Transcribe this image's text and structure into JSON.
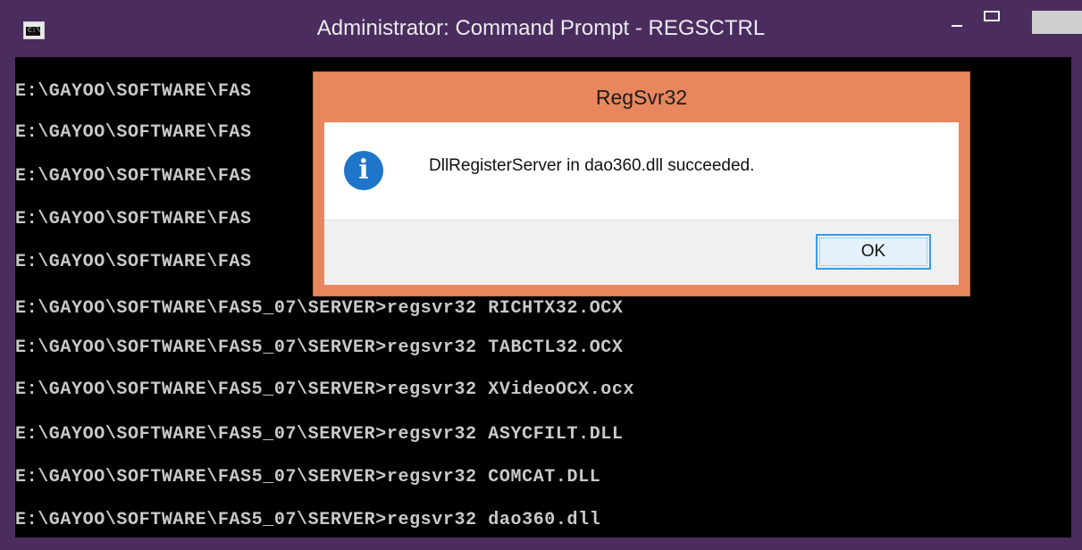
{
  "window": {
    "title": "Administrator: Command Prompt - REGSCTRL",
    "icon_text": "C:\\_",
    "icon_name": "command-prompt-icon"
  },
  "console": {
    "lines": [
      "E:\\GAYOO\\SOFTWARE\\FAS",
      "E:\\GAYOO\\SOFTWARE\\FAS",
      "E:\\GAYOO\\SOFTWARE\\FAS",
      "E:\\GAYOO\\SOFTWARE\\FAS",
      "E:\\GAYOO\\SOFTWARE\\FAS",
      "E:\\GAYOO\\SOFTWARE\\FAS5_07\\SERVER>regsvr32 RICHTX32.OCX",
      "E:\\GAYOO\\SOFTWARE\\FAS5_07\\SERVER>regsvr32 TABCTL32.OCX",
      "E:\\GAYOO\\SOFTWARE\\FAS5_07\\SERVER>regsvr32 XVideoOCX.ocx",
      "E:\\GAYOO\\SOFTWARE\\FAS5_07\\SERVER>regsvr32 ASYCFILT.DLL",
      "E:\\GAYOO\\SOFTWARE\\FAS5_07\\SERVER>regsvr32 COMCAT.DLL",
      "E:\\GAYOO\\SOFTWARE\\FAS5_07\\SERVER>regsvr32 dao360.dll"
    ],
    "text_color": "#c9c9c9",
    "background_color": "#000000"
  },
  "dialog": {
    "title": "RegSvr32",
    "message": "DllRegisterServer in dao360.dll succeeded.",
    "icon_name": "info-icon",
    "icon_glyph": "i",
    "ok_label": "OK",
    "accent_color": "#e8875e"
  }
}
